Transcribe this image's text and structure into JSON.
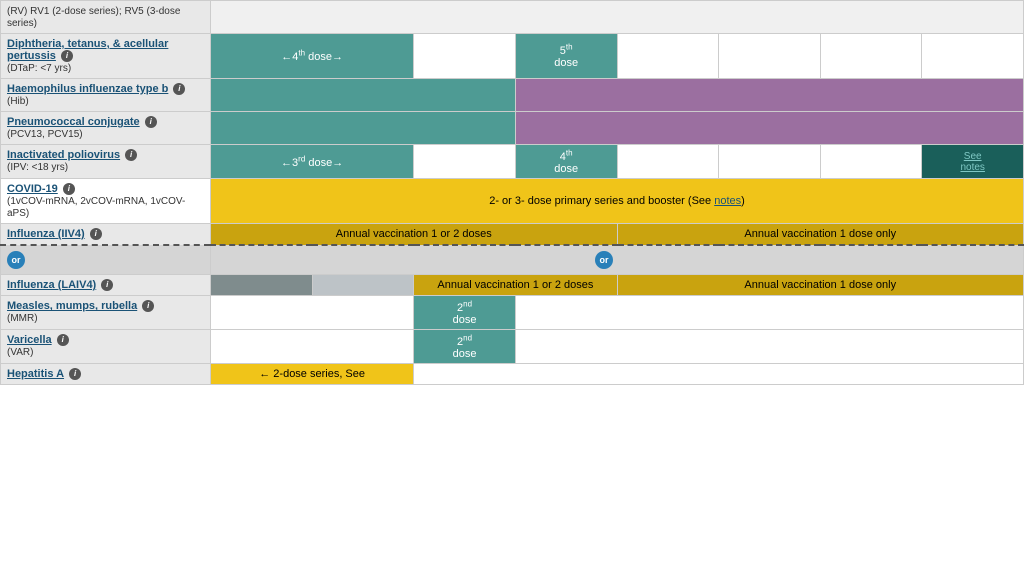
{
  "vaccines": [
    {
      "id": "rv",
      "name": "(RV) RV1 (2-dose series); RV5 (3-dose series)",
      "link": false,
      "sub": null
    },
    {
      "id": "dtap",
      "name": "Diphtheria, tetanus, & acellular pertussis",
      "link": true,
      "sub": "(DTaP: <7 yrs)",
      "info": true
    },
    {
      "id": "hib",
      "name": "Haemophilus influenzae type b",
      "link": true,
      "sub": "(Hib)",
      "info": true
    },
    {
      "id": "pcv",
      "name": "Pneumococcal conjugate",
      "link": true,
      "sub": "(PCV13, PCV15)",
      "info": true
    },
    {
      "id": "ipv",
      "name": "Inactivated poliovirus",
      "link": true,
      "sub": "(IPV: <18 yrs)",
      "info": true
    },
    {
      "id": "covid",
      "name": "COVID-19",
      "link": true,
      "sub": "(1vCOV-mRNA, 2vCOV-mRNA, 1vCOV-aPS)",
      "info": true
    },
    {
      "id": "iiv4",
      "name": "Influenza (IIV4)",
      "link": true,
      "sub": null,
      "info": true
    },
    {
      "id": "laiv4",
      "name": "Influenza (LAIV4)",
      "link": true,
      "sub": null,
      "info": true
    },
    {
      "id": "mmr",
      "name": "Measles, mumps, rubella",
      "link": true,
      "sub": "(MMR)",
      "info": true
    },
    {
      "id": "var",
      "name": "Varicella",
      "link": true,
      "sub": "(VAR)",
      "info": true
    },
    {
      "id": "hepa",
      "name": "Hepatitis A",
      "link": true,
      "sub": null,
      "info": true
    }
  ],
  "labels": {
    "covid_text": "2- or 3- dose primary series and booster (See notes)",
    "covid_notes": "notes",
    "iiv4_left": "Annual vaccination 1 or 2 doses",
    "iiv4_right": "Annual vaccination 1 dose only",
    "laiv4_center": "Annual vaccination 1 or 2 doses",
    "laiv4_right": "Annual vaccination 1 dose only",
    "dose4th": "4",
    "dose5th": "5",
    "dose2nd": "2",
    "dose3rd": "3",
    "see_notes": "See notes",
    "arrow_3rd": "←3rd dose→",
    "arrow_4th": "←4th dose→",
    "arrow_2dose": "← 2-dose series, See"
  }
}
